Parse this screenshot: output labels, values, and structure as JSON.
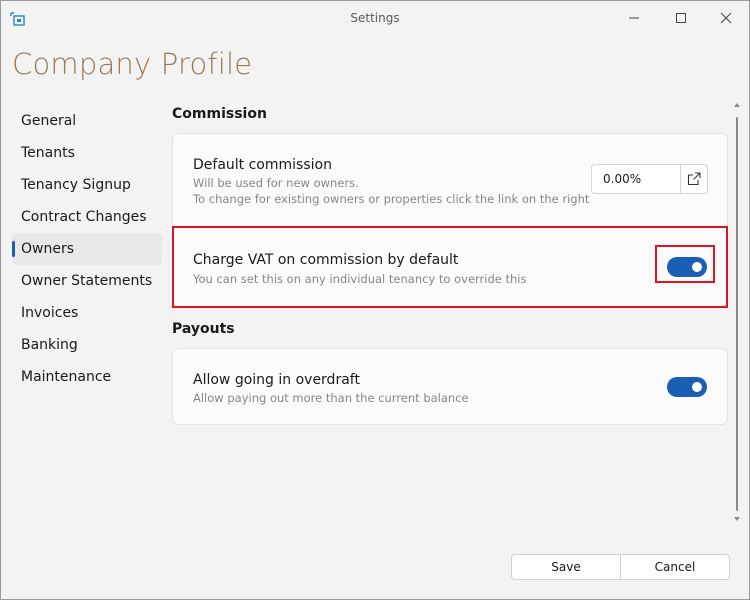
{
  "window": {
    "title": "Settings",
    "app_icon": "app-icon",
    "controls": [
      "minimize-icon",
      "maximize-icon",
      "close-icon"
    ]
  },
  "page": {
    "heading": "Company Profile"
  },
  "sidebar": {
    "items": [
      {
        "label": "General"
      },
      {
        "label": "Tenants"
      },
      {
        "label": "Tenancy Signup"
      },
      {
        "label": "Contract Changes"
      },
      {
        "label": "Owners",
        "active": true
      },
      {
        "label": "Owner Statements"
      },
      {
        "label": "Invoices"
      },
      {
        "label": "Banking"
      },
      {
        "label": "Maintenance"
      }
    ]
  },
  "commission": {
    "title": "Commission",
    "default_commission": {
      "label": "Default commission",
      "desc1": "Will be used for new owners.",
      "desc2": "To change for existing owners or properties click the link on the right",
      "value": "0.00%",
      "link_icon": "open-external-icon"
    },
    "charge_vat": {
      "label": "Charge VAT on commission by default",
      "desc": "You can set this on any individual tenancy to override this",
      "enabled": true
    }
  },
  "payouts": {
    "title": "Payouts",
    "overdraft": {
      "label": "Allow going in overdraft",
      "desc": "Allow paying out more than the current balance",
      "enabled": true
    }
  },
  "footer": {
    "save_label": "Save",
    "cancel_label": "Cancel"
  },
  "colors": {
    "accent": "#1a5fb4",
    "heading": "#9a7a55",
    "highlight": "#e0141e"
  }
}
